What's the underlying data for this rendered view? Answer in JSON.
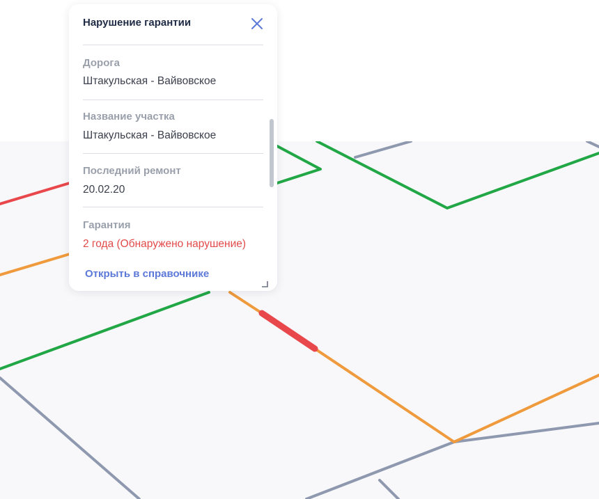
{
  "popup": {
    "title": "Нарушение гарантии",
    "close_icon": "close-icon",
    "fields": [
      {
        "label": "Дорога",
        "value": "Штакульская - Вайвовское"
      },
      {
        "label": "Название участка",
        "value": "Штакульская - Вайвовское"
      },
      {
        "label": "Последний ремонт",
        "value": "20.02.20"
      },
      {
        "label": "Гарантия",
        "value": "2 года (Обнаружено нарушение)"
      }
    ],
    "open_link": "Открыть в справочнике",
    "resize_icon": "resize-corner-icon"
  },
  "colors": {
    "road_gray": "#8e98ae",
    "road_green": "#22a746",
    "road_orange": "#ef9a3c",
    "road_red": "#e8474b",
    "alert_text": "#e24a4a",
    "link": "#5c78d8",
    "map_background": "#f8f8fa"
  }
}
